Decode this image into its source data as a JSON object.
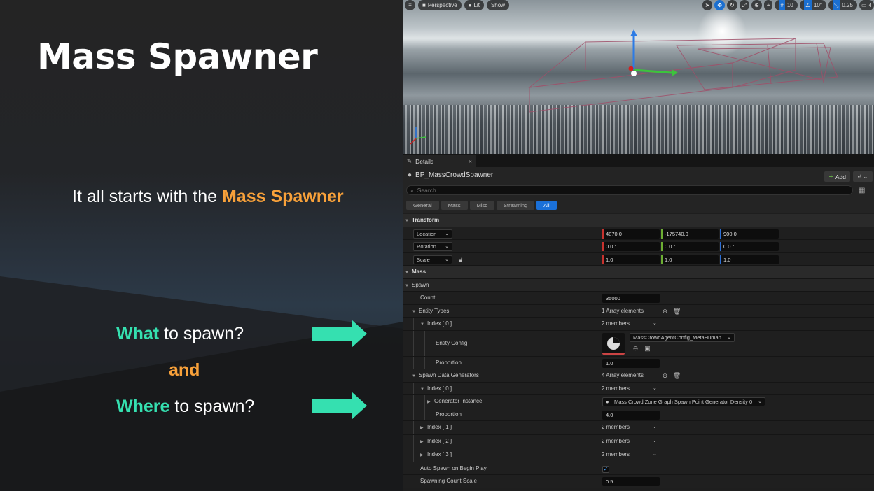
{
  "slide": {
    "title": "Mass Spawner",
    "intro_prefix": "It all starts with the ",
    "intro_highlight": "Mass Spawner",
    "q1_highlight": "What",
    "q1_rest": " to spawn?",
    "and": "and",
    "q2_highlight": "Where",
    "q2_rest": " to spawn?",
    "colors": {
      "orange": "#f8a13a",
      "green": "#35e0b0"
    }
  },
  "viewport": {
    "menu_icon": "hamburger-icon",
    "perspective_label": "Perspective",
    "lit_label": "Lit",
    "show_label": "Show",
    "grid_snap": "10",
    "rotation_snap": "10°",
    "scale_snap": "0.25",
    "camera_speed": "4"
  },
  "details": {
    "tab_label": "Details",
    "tab_close": "×",
    "actor_name": "BP_MassCrowdSpawner",
    "add_label": "Add",
    "search_placeholder": "Search",
    "filters": [
      "General",
      "Mass",
      "Misc",
      "Streaming",
      "All"
    ],
    "active_filter": "All",
    "transform": {
      "header": "Transform",
      "location_label": "Location",
      "location": [
        "4870.0",
        "-175740.0",
        "900.0"
      ],
      "rotation_label": "Rotation",
      "rotation": [
        "0.0 °",
        "0.0 °",
        "0.0 °"
      ],
      "scale_label": "Scale",
      "scale": [
        "1.0",
        "1.0",
        "1.0"
      ]
    },
    "mass_header": "Mass",
    "spawn": {
      "header": "Spawn",
      "count_label": "Count",
      "count_value": "35000",
      "entity_types_label": "Entity Types",
      "entity_types_value": "1 Array elements",
      "index0_label": "Index [ 0 ]",
      "index0_value": "2 members",
      "entity_config_label": "Entity Config",
      "entity_config_value": "MassCrowdAgentConfig_MetaHuman",
      "proportion_label": "Proportion",
      "proportion_value": "1.0",
      "generators_label": "Spawn Data Generators",
      "generators_value": "4 Array elements",
      "gen_index0_label": "Index [ 0 ]",
      "gen_index0_value": "2 members",
      "generator_instance_label": "Generator Instance",
      "generator_instance_value": "Mass Crowd Zone Graph Spawn Point Generator Density 0",
      "gen_proportion_label": "Proportion",
      "gen_proportion_value": "4.0",
      "gen_index1_label": "Index [ 1 ]",
      "gen_index1_value": "2 members",
      "gen_index2_label": "Index [ 2 ]",
      "gen_index2_value": "2 members",
      "gen_index3_label": "Index [ 3 ]",
      "gen_index3_value": "2 members",
      "auto_spawn_label": "Auto Spawn on Begin Play",
      "auto_spawn_checked": true,
      "spawn_scale_label": "Spawning Count Scale",
      "spawn_scale_value": "0.5"
    }
  }
}
